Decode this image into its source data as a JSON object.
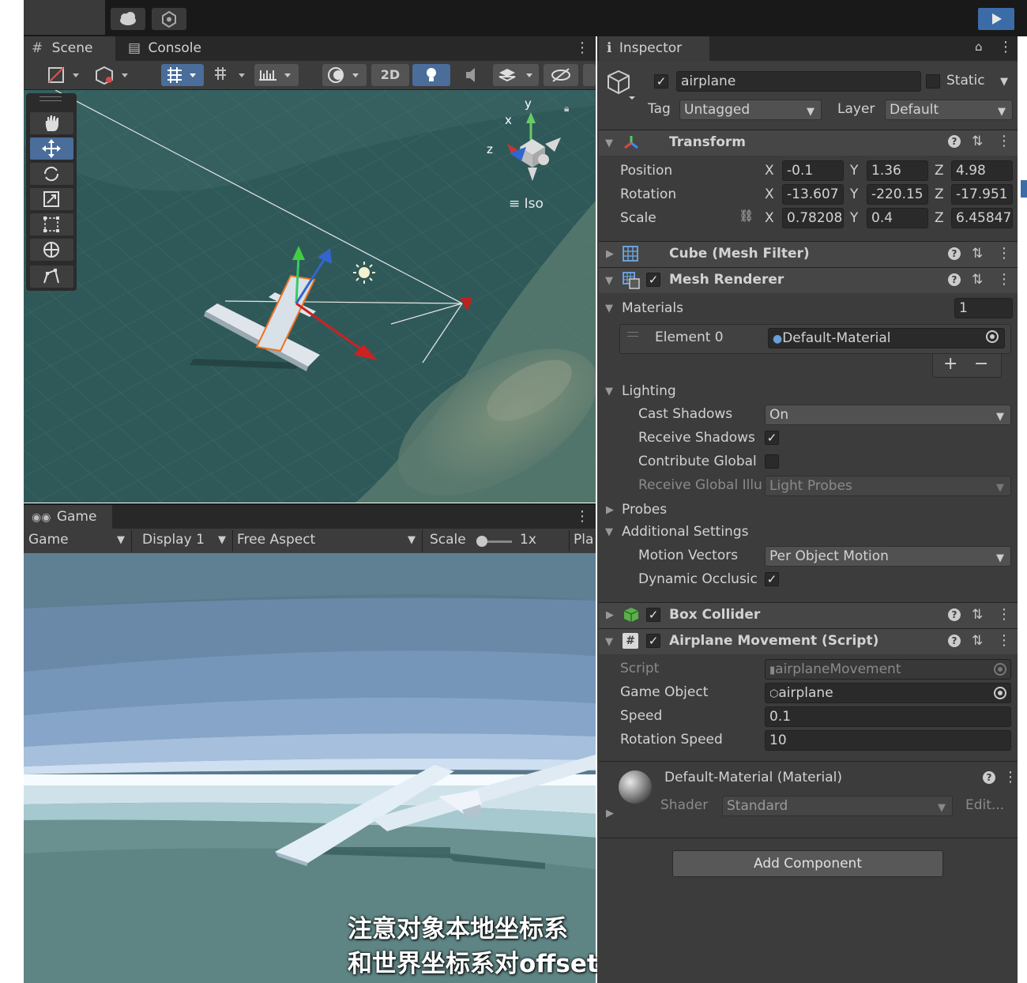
{
  "scene_tabs": {
    "scene": "Scene",
    "console": "Console"
  },
  "scene_toolbar": {
    "mode_2d": "2D"
  },
  "gizmo": {
    "axis_x": "x",
    "axis_y": "y",
    "axis_z": "z",
    "projection": "Iso"
  },
  "game": {
    "tab": "Game",
    "view_select": "Game",
    "display": "Display 1",
    "aspect": "Free Aspect",
    "scale_label": "Scale",
    "scale_value": "1x",
    "play_partial": "Pla"
  },
  "caption": {
    "line1": "注意对象本地坐标系",
    "line2": "和世界坐标系对offset的影响"
  },
  "inspector": {
    "tab": "Inspector",
    "object_name": "airplane",
    "static_label": "Static",
    "tag_label": "Tag",
    "tag_value": "Untagged",
    "layer_label": "Layer",
    "layer_value": "Default",
    "transform": {
      "title": "Transform",
      "position_label": "Position",
      "rotation_label": "Rotation",
      "scale_label": "Scale",
      "axis_x": "X",
      "axis_y": "Y",
      "axis_z": "Z",
      "position": [
        "-0.1",
        "1.36",
        "4.98"
      ],
      "rotation": [
        "-13.607",
        "-220.15",
        "-17.951"
      ],
      "scale": [
        "0.78208",
        "0.4",
        "6.45847"
      ]
    },
    "mesh_filter": {
      "title": "Cube (Mesh Filter)"
    },
    "mesh_renderer": {
      "title": "Mesh Renderer",
      "materials_label": "Materials",
      "materials_count": "1",
      "element_label": "Element 0",
      "element_value": "Default-Material",
      "plus": "+",
      "minus": "−",
      "lighting_label": "Lighting",
      "cast_shadows_label": "Cast Shadows",
      "cast_shadows_value": "On",
      "receive_shadows_label": "Receive Shadows",
      "contribute_gi_label": "Contribute Global",
      "receive_gi_label": "Receive Global Illu",
      "receive_gi_value": "Light Probes",
      "probes_label": "Probes",
      "additional_label": "Additional Settings",
      "motion_vectors_label": "Motion Vectors",
      "motion_vectors_value": "Per Object Motion",
      "dynamic_occlusion_label": "Dynamic Occlusic"
    },
    "box_collider": {
      "title": "Box Collider"
    },
    "script": {
      "title": "Airplane Movement (Script)",
      "script_label": "Script",
      "script_value": "airplaneMovement",
      "game_object_label": "Game Object",
      "game_object_value": "airplane",
      "speed_label": "Speed",
      "speed_value": "0.1",
      "rotation_speed_label": "Rotation Speed",
      "rotation_speed_value": "10"
    },
    "material": {
      "title": "Default-Material (Material)",
      "shader_label": "Shader",
      "shader_value": "Standard",
      "edit_label": "Edit..."
    },
    "add_component": "Add Component",
    "colors": {
      "panel": "#3c3c3c",
      "header": "#464646",
      "field": "#2a2a2a",
      "accent": "#3c6ca8"
    }
  }
}
